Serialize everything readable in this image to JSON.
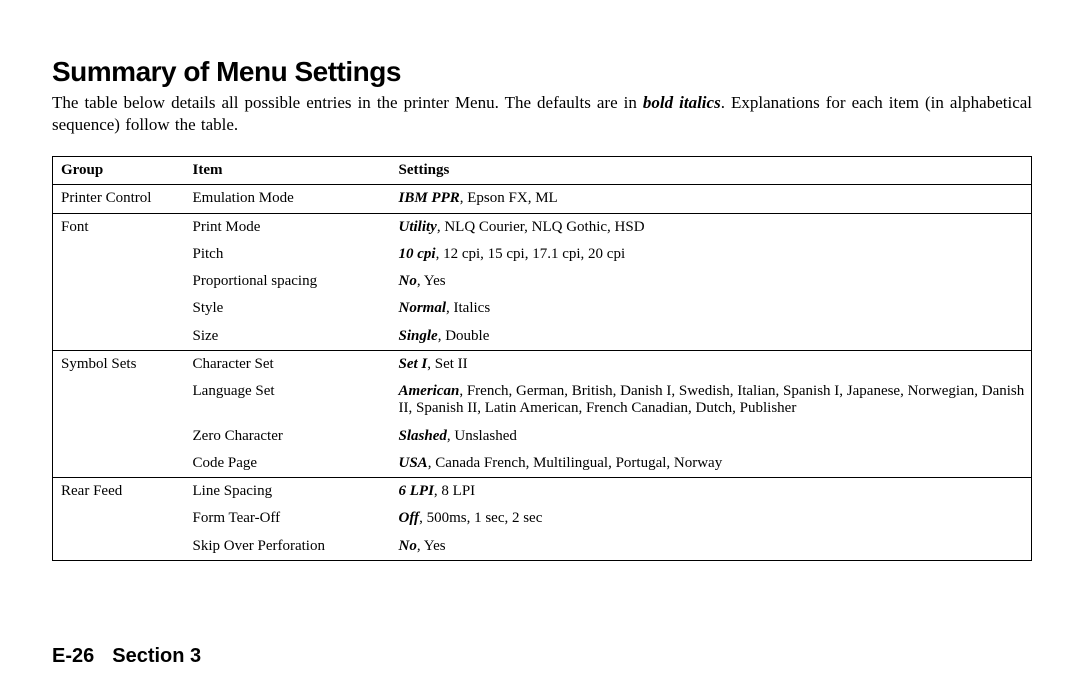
{
  "title": "Summary of Menu Settings",
  "intro_pre": "The table below details all possible entries in the printer Menu. The defaults are in ",
  "intro_emph": "bold italics",
  "intro_post": ". Explanations for each item (in alphabetical sequence) follow the table.",
  "headers": {
    "group": "Group",
    "item": "Item",
    "settings": "Settings"
  },
  "rows": [
    {
      "sep": true,
      "group": "Printer Control",
      "item": "Emulation Mode",
      "def": "IBM PPR",
      "rest": ", Epson FX, ML"
    },
    {
      "sep": true,
      "group": "Font",
      "item": "Print Mode",
      "def": "Utility",
      "rest": ", NLQ Courier, NLQ Gothic, HSD"
    },
    {
      "sep": false,
      "group": "",
      "item": "Pitch",
      "def": "10 cpi",
      "rest": ", 12 cpi, 15 cpi, 17.1 cpi, 20 cpi"
    },
    {
      "sep": false,
      "group": "",
      "item": "Proportional spacing",
      "def": "No",
      "rest": ", Yes"
    },
    {
      "sep": false,
      "group": "",
      "item": "Style",
      "def": "Normal",
      "rest": ", Italics"
    },
    {
      "sep": false,
      "group": "",
      "item": "Size",
      "def": "Single",
      "rest": ", Double"
    },
    {
      "sep": true,
      "group": "Symbol Sets",
      "item": "Character Set",
      "def": "Set I",
      "rest": ", Set II"
    },
    {
      "sep": false,
      "group": "",
      "item": "Language Set",
      "def": "American",
      "rest": ", French, German, British, Danish I, Swedish, Italian, Spanish I, Japanese, Norwegian, Danish II, Spanish II, Latin American, French Canadian, Dutch, Publisher"
    },
    {
      "sep": false,
      "group": "",
      "item": "Zero Character",
      "def": "Slashed",
      "rest": ", Unslashed"
    },
    {
      "sep": false,
      "group": "",
      "item": "Code Page",
      "def": "USA",
      "rest": ", Canada French, Multilingual, Portugal, Norway"
    },
    {
      "sep": true,
      "group": "Rear Feed",
      "item": "Line Spacing",
      "def": "6 LPI",
      "rest": ", 8 LPI"
    },
    {
      "sep": false,
      "group": "",
      "item": "Form Tear-Off",
      "def": "Off",
      "rest": ", 500ms, 1 sec, 2 sec"
    },
    {
      "sep": false,
      "group": "",
      "item": "Skip Over Perforation",
      "def": "No",
      "rest": ", Yes"
    }
  ],
  "footer": {
    "page": "E-26",
    "section": "Section 3"
  }
}
